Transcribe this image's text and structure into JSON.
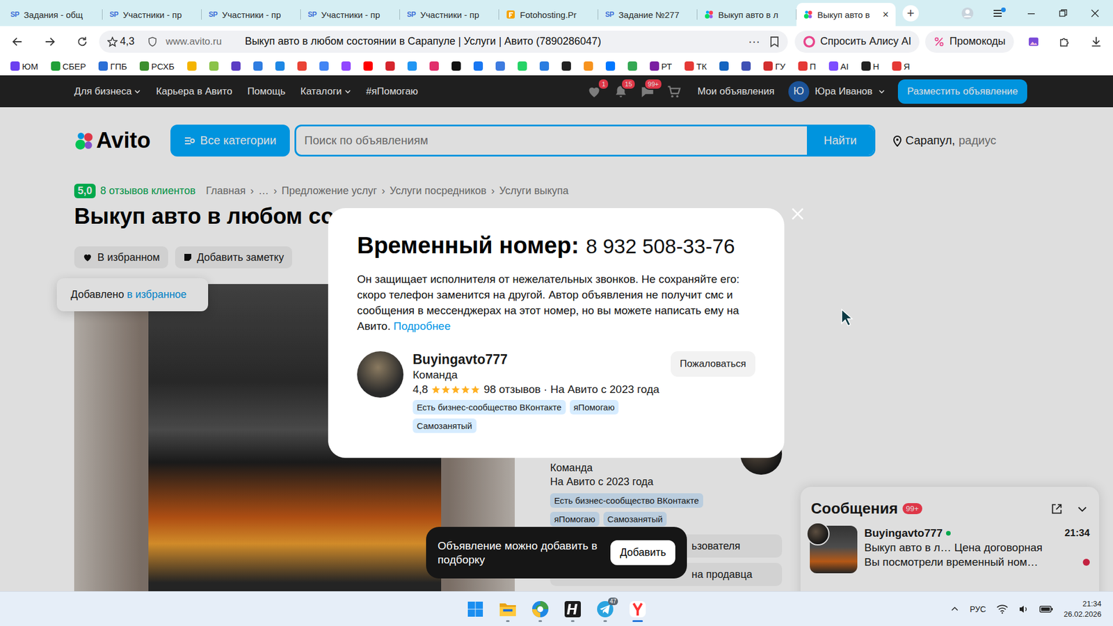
{
  "browser": {
    "tabs": [
      {
        "label": "Задания - общ",
        "kind": "sp",
        "icon_text": "SP",
        "selected": false
      },
      {
        "label": "Участники - пр",
        "kind": "sp",
        "icon_text": "SP",
        "selected": false
      },
      {
        "label": "Участники - пр",
        "kind": "sp",
        "icon_text": "SP",
        "selected": false
      },
      {
        "label": "Участники - пр",
        "kind": "sp",
        "icon_text": "SP",
        "selected": false
      },
      {
        "label": "Участники - пр",
        "kind": "sp",
        "icon_text": "SP",
        "selected": false
      },
      {
        "label": "Fotohosting.Pr",
        "kind": "fotohosting",
        "selected": false
      },
      {
        "label": "Задание №277",
        "kind": "sp",
        "icon_text": "SP",
        "selected": false
      },
      {
        "label": "Выкуп авто в л",
        "kind": "avito",
        "selected": false
      },
      {
        "label": "Выкуп авто в",
        "kind": "avito",
        "selected": true,
        "close": "×"
      }
    ],
    "new_tab": "+",
    "address": {
      "rating": "4,3",
      "domain": "www.avito.ru",
      "page_title": "Выкуп авто в любом состоянии в Сарапуле | Услуги | Авито (7890286047)",
      "more": "⋯"
    },
    "alice": "Спросить Алису AI",
    "promo": "Промокоды",
    "bookmarks": [
      {
        "kind": "labeled",
        "label": "ЮМ",
        "color": "#6b3ff0"
      },
      {
        "kind": "labeled",
        "label": "СБЕР",
        "color": "#21a038"
      },
      {
        "kind": "labeled",
        "label": "ГПБ",
        "color": "#2b6fd6"
      },
      {
        "kind": "labeled",
        "label": "РСХБ",
        "color": "#3c8f2e"
      },
      {
        "kind": "icon",
        "color": "#f4b400"
      },
      {
        "kind": "icon",
        "color": "#8bc34a"
      },
      {
        "kind": "icon",
        "color": "#5b3cc4"
      },
      {
        "kind": "icon",
        "color": "#2f7de1"
      },
      {
        "kind": "icon",
        "color": "#1e88e5"
      },
      {
        "kind": "icon",
        "color": "#ea4335"
      },
      {
        "kind": "icon",
        "color": "#4285f4"
      },
      {
        "kind": "icon",
        "color": "#9146ff"
      },
      {
        "kind": "icon",
        "color": "#ff0000"
      },
      {
        "kind": "icon",
        "color": "#d6252d"
      },
      {
        "kind": "icon",
        "color": "#2196f3"
      },
      {
        "kind": "icon",
        "color": "#e1306c"
      },
      {
        "kind": "icon",
        "color": "#111111"
      },
      {
        "kind": "icon",
        "color": "#1877f2"
      },
      {
        "kind": "icon",
        "color": "#3d7be0"
      },
      {
        "kind": "icon",
        "color": "#25d366"
      },
      {
        "kind": "icon",
        "color": "#2a7de1"
      },
      {
        "kind": "icon",
        "color": "#222222"
      },
      {
        "kind": "icon",
        "color": "#f7931e"
      },
      {
        "kind": "icon",
        "color": "#0077ff"
      },
      {
        "kind": "icon",
        "color": "#34a853"
      },
      {
        "kind": "labeled",
        "label": "РТ",
        "color": "#7b1fa2"
      },
      {
        "kind": "labeled",
        "label": "ТК",
        "color": "#e53935"
      },
      {
        "kind": "icon",
        "color": "#1565c0"
      },
      {
        "kind": "icon",
        "color": "#3f51b5"
      },
      {
        "kind": "labeled",
        "label": "ГУ",
        "color": "#d32f2f"
      },
      {
        "kind": "labeled",
        "label": "П",
        "color": "#e53935"
      },
      {
        "kind": "labeled",
        "label": "AI",
        "color": "#7c4dff"
      },
      {
        "kind": "labeled",
        "label": "Н",
        "color": "#222222"
      },
      {
        "kind": "labeled",
        "label": "Я",
        "color": "#e53935"
      }
    ]
  },
  "avito_nav": {
    "menu": [
      {
        "label": "Для бизнеса",
        "dropdown": true
      },
      {
        "label": "Карьера в Авито",
        "dropdown": false
      },
      {
        "label": "Помощь",
        "dropdown": false
      },
      {
        "label": "Каталоги",
        "dropdown": true
      },
      {
        "label": "#яПомогаю",
        "dropdown": false
      }
    ],
    "icons": [
      {
        "kind": "heart",
        "badge": "1"
      },
      {
        "kind": "bell",
        "badge": "15"
      },
      {
        "kind": "chat",
        "badge": "99+"
      },
      {
        "kind": "cart"
      }
    ],
    "my_ads": "Мои объявления",
    "user": {
      "initial": "Ю",
      "name": "Юра Иванов"
    },
    "post_button": "Разместить объявление"
  },
  "header": {
    "logo": "Avito",
    "categories": "Все категории",
    "search_placeholder": "Поиск по объявлениям",
    "search_button": "Найти",
    "location": "Сарапул,",
    "radius": "радиус"
  },
  "listing": {
    "rating": "5,0",
    "reviews": "8 отзывов клиентов",
    "breadcrumbs": [
      "Главная",
      "…",
      "Предложение услуг",
      "Услуги посредников",
      "Услуги выкупа"
    ],
    "crumb_sep": "›",
    "title": "Выкуп авто в любом со",
    "favorite": {
      "label": "В избранном",
      "on": true
    },
    "note": "Добавить заметку",
    "added": {
      "text": "Добавлено",
      "link": "в избранное"
    }
  },
  "seller_card": {
    "role": "Команда",
    "since": "На Авито с 2023 года",
    "tags": [
      "Есть бизнес-сообщество ВКонтакте",
      "яПомогаю",
      "Самозанятый"
    ],
    "buttons": [
      "ьзователя",
      "на продавца"
    ]
  },
  "modal": {
    "title": "Временный номер:",
    "phone": "8 932 508-33-76",
    "text": "Он защищает исполнителя от нежелательных звонков. Не сохраняйте его: скоро телефон заменится на другой. Автор объявления не получит смс и сообщения в мессенджерах на этот номер, но вы можете написать ему на Авито.",
    "more_link": "Подробнее",
    "seller": {
      "name": "Buyingavto777",
      "role": "Команда",
      "rating": "4,8",
      "stars": 5,
      "reviews": "98 отзывов · На Авито с 2023 года",
      "tags": [
        "Есть бизнес-сообщество ВКонтакте",
        "яПомогаю",
        "Самозанятый"
      ]
    },
    "report": "Пожаловаться"
  },
  "toast": {
    "text": "Объявление можно добавить в подборку",
    "button": "Добавить"
  },
  "messages": {
    "title": "Сообщения",
    "badge": "99+",
    "items": [
      {
        "name": "Buyingavto777",
        "online": true,
        "time": "21:34",
        "preview": "Выкуп авто в л… Цена договорная",
        "last": "Вы посмотрели временный ном…",
        "unread": true
      }
    ]
  },
  "taskbar": {
    "apps": [
      {
        "kind": "start",
        "running": false,
        "selected": false
      },
      {
        "kind": "explorer",
        "running": true,
        "selected": false
      },
      {
        "kind": "edge",
        "running": true,
        "selected": false
      },
      {
        "kind": "h-app",
        "running": true,
        "selected": false
      },
      {
        "kind": "telegram",
        "running": true,
        "selected": false,
        "badge": "47"
      },
      {
        "kind": "yandex",
        "running": true,
        "selected": true
      }
    ],
    "lang": "РУС",
    "time": "21:34",
    "date": "26.02.2026"
  }
}
